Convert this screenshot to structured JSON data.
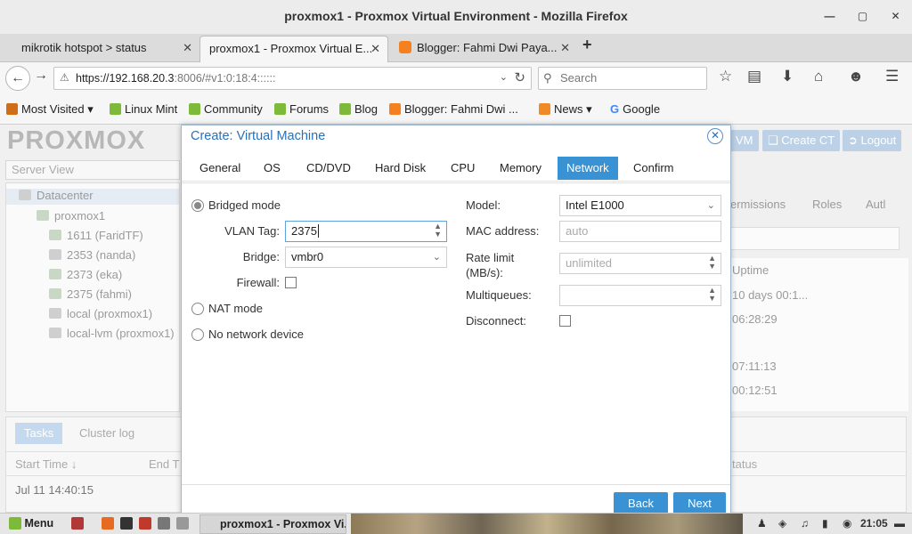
{
  "window": {
    "title": "proxmox1 - Proxmox Virtual Environment - Mozilla Firefox"
  },
  "tabs": [
    {
      "label": "mikrotik hotspot > status"
    },
    {
      "label": "proxmox1 - Proxmox Virtual E..."
    },
    {
      "label": "Blogger: Fahmi Dwi Paya..."
    }
  ],
  "nav": {
    "url_host": "https://192.168.20.3",
    "url_rest": ":8006/#v1:0:18:4::::::",
    "search_placeholder": "Search"
  },
  "bookmarks": [
    "Most Visited",
    "Linux Mint",
    "Community",
    "Forums",
    "Blog",
    "Blogger: Fahmi Dwi ...",
    "News",
    "Google"
  ],
  "pve": {
    "logo": "PROXMOX",
    "server_view": "Server View",
    "tree": [
      "Datacenter",
      "proxmox1",
      "1611 (FaridTF)",
      "2353 (nanda)",
      "2373 (eka)",
      "2375 (fahmi)",
      "local (proxmox1)",
      "local-lvm (proxmox1)"
    ],
    "top_buttons": [
      "VM",
      "Create CT",
      "Logout"
    ],
    "right_tabs": [
      "ermissions",
      "Roles",
      "Autl"
    ],
    "uptime_header": "Uptime",
    "uptimes": [
      "10 days 00:1...",
      "06:28:29",
      "07:11:13",
      "00:12:51"
    ],
    "bottom_tabs": [
      "Tasks",
      "Cluster log"
    ],
    "task_headers": [
      "Start Time ↓",
      "End T",
      "tatus"
    ],
    "task_rows": [
      "Jul 11 14:40:15"
    ]
  },
  "dialog": {
    "title": "Create: Virtual Machine",
    "tabs": [
      "General",
      "OS",
      "CD/DVD",
      "Hard Disk",
      "CPU",
      "Memory",
      "Network",
      "Confirm"
    ],
    "active_tab": "Network",
    "bridged_mode": "Bridged mode",
    "vlan_tag_label": "VLAN Tag:",
    "vlan_tag_value": "2375",
    "bridge_label": "Bridge:",
    "bridge_value": "vmbr0",
    "firewall_label": "Firewall:",
    "nat_mode": "NAT mode",
    "no_network": "No network device",
    "model_label": "Model:",
    "model_value": "Intel E1000",
    "mac_label": "MAC address:",
    "mac_placeholder": "auto",
    "rate_label_1": "Rate limit",
    "rate_label_2": "(MB/s):",
    "rate_placeholder": "unlimited",
    "multiqueues_label": "Multiqueues:",
    "disconnect_label": "Disconnect:",
    "back": "Back",
    "next": "Next"
  },
  "taskbar": {
    "menu": "Menu",
    "window": "proxmox1 - Proxmox Vi...",
    "clock": "21:05"
  }
}
